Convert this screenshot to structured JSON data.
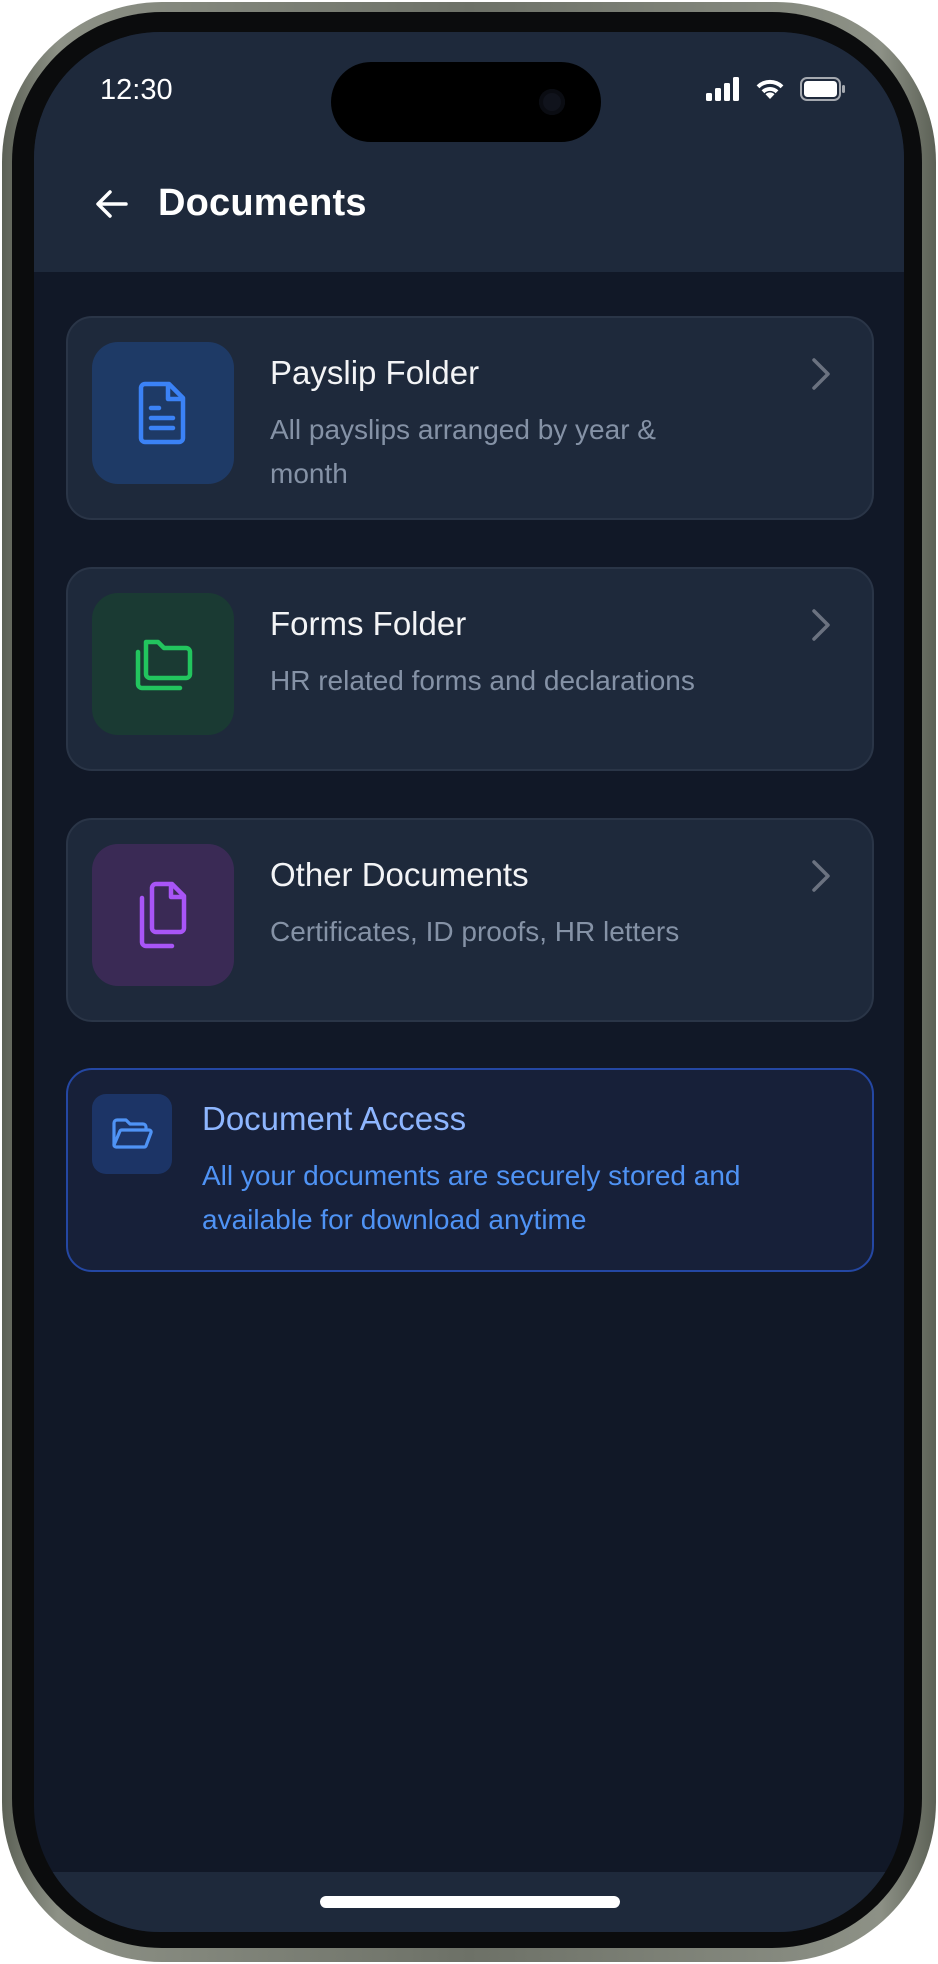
{
  "status_bar": {
    "time": "12:30",
    "icons": [
      "signal-icon",
      "wifi-icon",
      "battery-icon"
    ]
  },
  "header": {
    "back_icon": "arrow-left-icon",
    "title": "Documents"
  },
  "folders": [
    {
      "title": "Payslip Folder",
      "description": "All payslips arranged by year & month",
      "icon": "document-icon",
      "icon_color": "#3b82f6",
      "tile_color": "#1e3a66"
    },
    {
      "title": "Forms Folder",
      "description": "HR related forms and declarations",
      "icon": "folders-icon",
      "icon_color": "#22c55e",
      "tile_color": "#1a3a33"
    },
    {
      "title": "Other Documents",
      "description": "Certificates, ID proofs, HR letters",
      "icon": "files-icon",
      "icon_color": "#a855f7",
      "tile_color": "#3a2a55"
    }
  ],
  "info_banner": {
    "title": "Document Access",
    "description": "All your documents are securely stored and available for download anytime",
    "icon": "folder-open-icon",
    "accent": "#4f93f5"
  },
  "colors": {
    "background": "#111827",
    "surface": "#1e293b",
    "chevron": "#6b7280"
  }
}
